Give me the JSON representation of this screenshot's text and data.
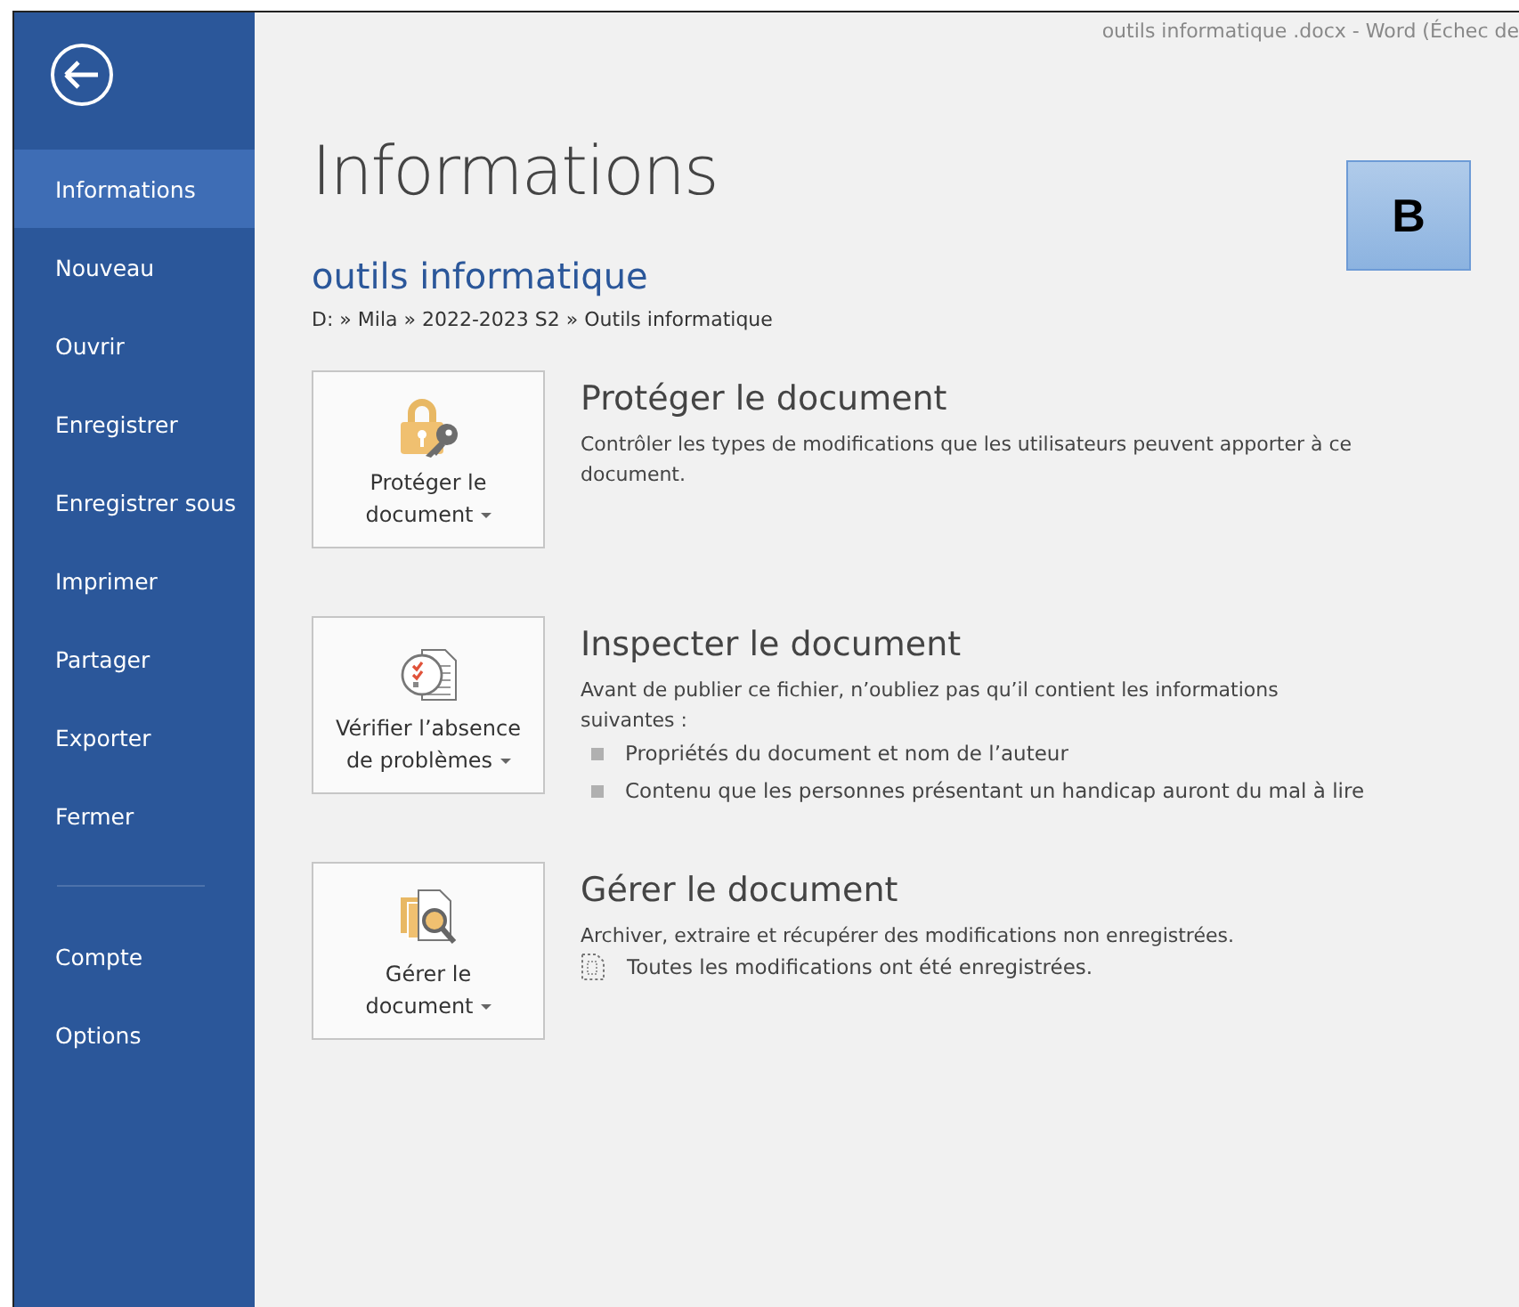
{
  "window": {
    "title": "outils informatique .docx - Word (Échec de"
  },
  "sidebar": {
    "items": [
      {
        "label": "Informations",
        "selected": true
      },
      {
        "label": "Nouveau",
        "selected": false
      },
      {
        "label": "Ouvrir",
        "selected": false
      },
      {
        "label": "Enregistrer",
        "selected": false
      },
      {
        "label": "Enregistrer sous",
        "selected": false
      },
      {
        "label": "Imprimer",
        "selected": false
      },
      {
        "label": "Partager",
        "selected": false
      },
      {
        "label": "Exporter",
        "selected": false
      },
      {
        "label": "Fermer",
        "selected": false
      }
    ],
    "footer_items": [
      {
        "label": "Compte",
        "selected": false
      },
      {
        "label": "Options",
        "selected": false
      }
    ]
  },
  "page": {
    "title": "Informations",
    "badge": "B",
    "document_name": "outils informatique",
    "path": "D: » Mila » 2022-2023 S2 » Outils informatique"
  },
  "sections": [
    {
      "kind": "protect",
      "button": [
        "Protéger le",
        "document"
      ],
      "heading": "Protéger le document",
      "description": "Contrôler les types de modifications que les utilisateurs peuvent apporter à ce document."
    },
    {
      "kind": "inspect",
      "button": [
        "Vérifier l’absence",
        "de problèmes"
      ],
      "heading": "Inspecter le document",
      "description": "Avant de publier ce fichier, n’oubliez pas qu’il contient les informations suivantes :",
      "items": [
        {
          "kind": "bullet",
          "text": "Propriétés du document et nom de l’auteur"
        },
        {
          "kind": "bullet",
          "text": "Contenu que les personnes présentant un handicap auront du mal à lire"
        }
      ]
    },
    {
      "kind": "manage",
      "button": [
        "Gérer le",
        "document"
      ],
      "heading": "Gérer le document",
      "description": "Archiver, extraire et récupérer des modifications non enregistrées.",
      "items": [
        {
          "kind": "status",
          "text": "Toutes les modifications ont été enregistrées."
        }
      ]
    }
  ]
}
